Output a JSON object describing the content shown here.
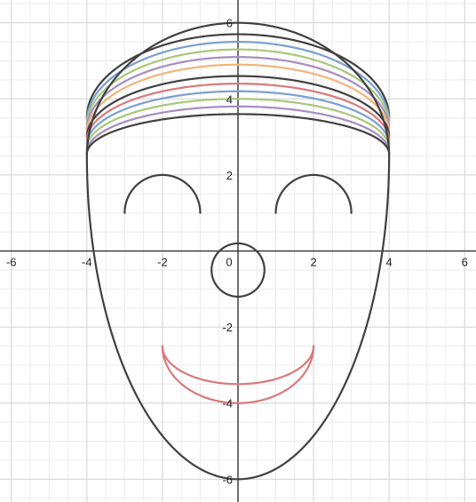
{
  "colors": {
    "background": "#ffffff",
    "grid_minor": "#ececec",
    "grid_major": "#d2d2d2",
    "axis": "#222222",
    "dark": "#404040",
    "blue": "#7b9fd2",
    "green": "#a9c77a",
    "purple": "#a58ebf",
    "orange": "#f3b47b",
    "red": "#d9797a"
  },
  "axes": {
    "xlim": [
      -6.3,
      6.3
    ],
    "ylim": [
      -6.6,
      6.6
    ],
    "x_tick_labels": [
      "-6",
      "-4",
      "-2",
      "0",
      "2",
      "4",
      "6"
    ],
    "y_tick_labels": [
      "6",
      "4",
      "2",
      "-2",
      "-4",
      "-6"
    ]
  },
  "chart_data": {
    "type": "line",
    "title": "",
    "xlabel": "",
    "ylabel": "",
    "grid": true,
    "face": {
      "ellipse_lower": {
        "center": [
          0,
          2.5
        ],
        "rx": 4,
        "ry": 8.5,
        "half": "lower",
        "color": "dark"
      },
      "ellipse_upper": {
        "center": [
          0,
          2.5
        ],
        "rx": 4,
        "ry": 3.5,
        "half": "upper",
        "color": "dark"
      },
      "left_eye": {
        "center": [
          -2,
          1
        ],
        "r": 1,
        "half": "upper",
        "color": "dark"
      },
      "right_eye": {
        "center": [
          2,
          1
        ],
        "r": 1,
        "half": "upper",
        "color": "dark"
      },
      "nose": {
        "center": [
          0,
          -0.5
        ],
        "r": 0.7,
        "color": "dark"
      },
      "mouth_outer": {
        "center": [
          0,
          -2.5
        ],
        "rx": 2,
        "ry": 1.5,
        "half": "lower",
        "color": "red"
      },
      "mouth_inner": {
        "center": [
          0,
          -2.5
        ],
        "rx": 2,
        "ry": 1.0,
        "half": "lower",
        "color": "red"
      }
    },
    "hair_arcs": [
      {
        "base_y": 3.5,
        "top_y": 5.7,
        "color": "dark"
      },
      {
        "base_y": 3.4,
        "top_y": 5.5,
        "color": "blue"
      },
      {
        "base_y": 3.3,
        "top_y": 5.3,
        "color": "green"
      },
      {
        "base_y": 3.2,
        "top_y": 5.1,
        "color": "purple"
      },
      {
        "base_y": 3.1,
        "top_y": 4.9,
        "color": "orange"
      },
      {
        "base_y": 3.0,
        "top_y": 4.6,
        "color": "dark"
      },
      {
        "base_y": 2.9,
        "top_y": 4.4,
        "color": "red"
      },
      {
        "base_y": 2.8,
        "top_y": 4.2,
        "color": "blue"
      },
      {
        "base_y": 2.7,
        "top_y": 4.0,
        "color": "green"
      },
      {
        "base_y": 2.6,
        "top_y": 3.8,
        "color": "purple"
      },
      {
        "base_y": 2.55,
        "top_y": 3.6,
        "color": "dark"
      }
    ]
  }
}
